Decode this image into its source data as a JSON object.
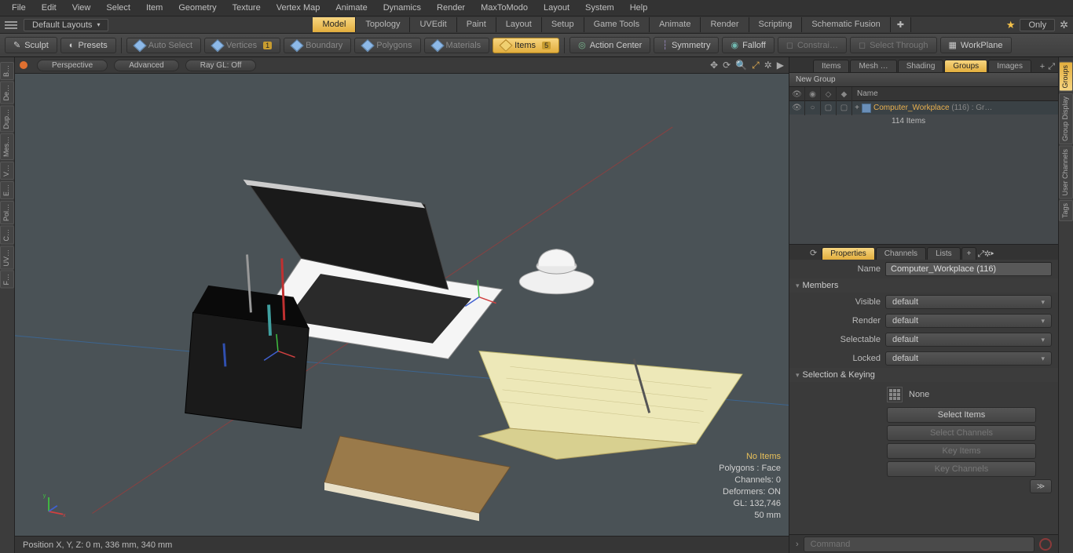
{
  "menu": [
    "File",
    "Edit",
    "View",
    "Select",
    "Item",
    "Geometry",
    "Texture",
    "Vertex Map",
    "Animate",
    "Dynamics",
    "Render",
    "MaxToModo",
    "Layout",
    "System",
    "Help"
  ],
  "layouts_dropdown": "Default Layouts",
  "mode_tabs": [
    "Model",
    "Topology",
    "UVEdit",
    "Paint",
    "Layout",
    "Setup",
    "Game Tools",
    "Animate",
    "Render",
    "Scripting",
    "Schematic Fusion"
  ],
  "active_mode_tab": "Model",
  "only_label": "Only",
  "toolbar": {
    "sculpt": "Sculpt",
    "presets": "Presets",
    "auto_select": "Auto Select",
    "vertices": "Vertices",
    "vertices_badge": "1",
    "boundary": "Boundary",
    "polygons": "Polygons",
    "materials": "Materials",
    "items": "Items",
    "items_badge": "5",
    "action_center": "Action Center",
    "symmetry": "Symmetry",
    "falloff": "Falloff",
    "constrain": "Constrai…",
    "select_through": "Select Through",
    "workplane": "WorkPlane"
  },
  "viewport": {
    "mode": "Perspective",
    "shading": "Advanced",
    "raygl": "Ray GL: Off",
    "overlay": {
      "no_items": "No Items",
      "polygons": "Polygons : Face",
      "channels": "Channels: 0",
      "deformers": "Deformers: ON",
      "gl": "GL: 132,746",
      "grid": "50 mm"
    }
  },
  "right": {
    "top_tabs": [
      "Items",
      "Mesh …",
      "Shading",
      "Groups",
      "Images"
    ],
    "top_active": "Groups",
    "new_group": "New Group",
    "col_name": "Name",
    "item_name": "Computer_Workplace",
    "item_suffix": "(116)",
    "item_tail": " : Gr…",
    "item_count": "114 Items",
    "prop_tabs": [
      "Properties",
      "Channels",
      "Lists"
    ],
    "prop_active": "Properties",
    "name_label": "Name",
    "name_value": "Computer_Workplace (116)",
    "members": "Members",
    "visible": "Visible",
    "render": "Render",
    "selectable": "Selectable",
    "locked": "Locked",
    "default_val": "default",
    "sel_key": "Selection & Keying",
    "none": "None",
    "select_items": "Select Items",
    "select_channels": "Select Channels",
    "key_items": "Key Items",
    "key_channels": "Key Channels"
  },
  "right_strip": [
    "Groups",
    "Group Display",
    "User Channels",
    "Tags"
  ],
  "left_strip": [
    "B…",
    "De…",
    "Dup…",
    "Mes…",
    "V…",
    "E…",
    "Pol…",
    "C…",
    "UV…",
    "F…"
  ],
  "status": "Position X, Y, Z:   0 m, 336 mm, 340 mm",
  "cmd_placeholder": "Command"
}
